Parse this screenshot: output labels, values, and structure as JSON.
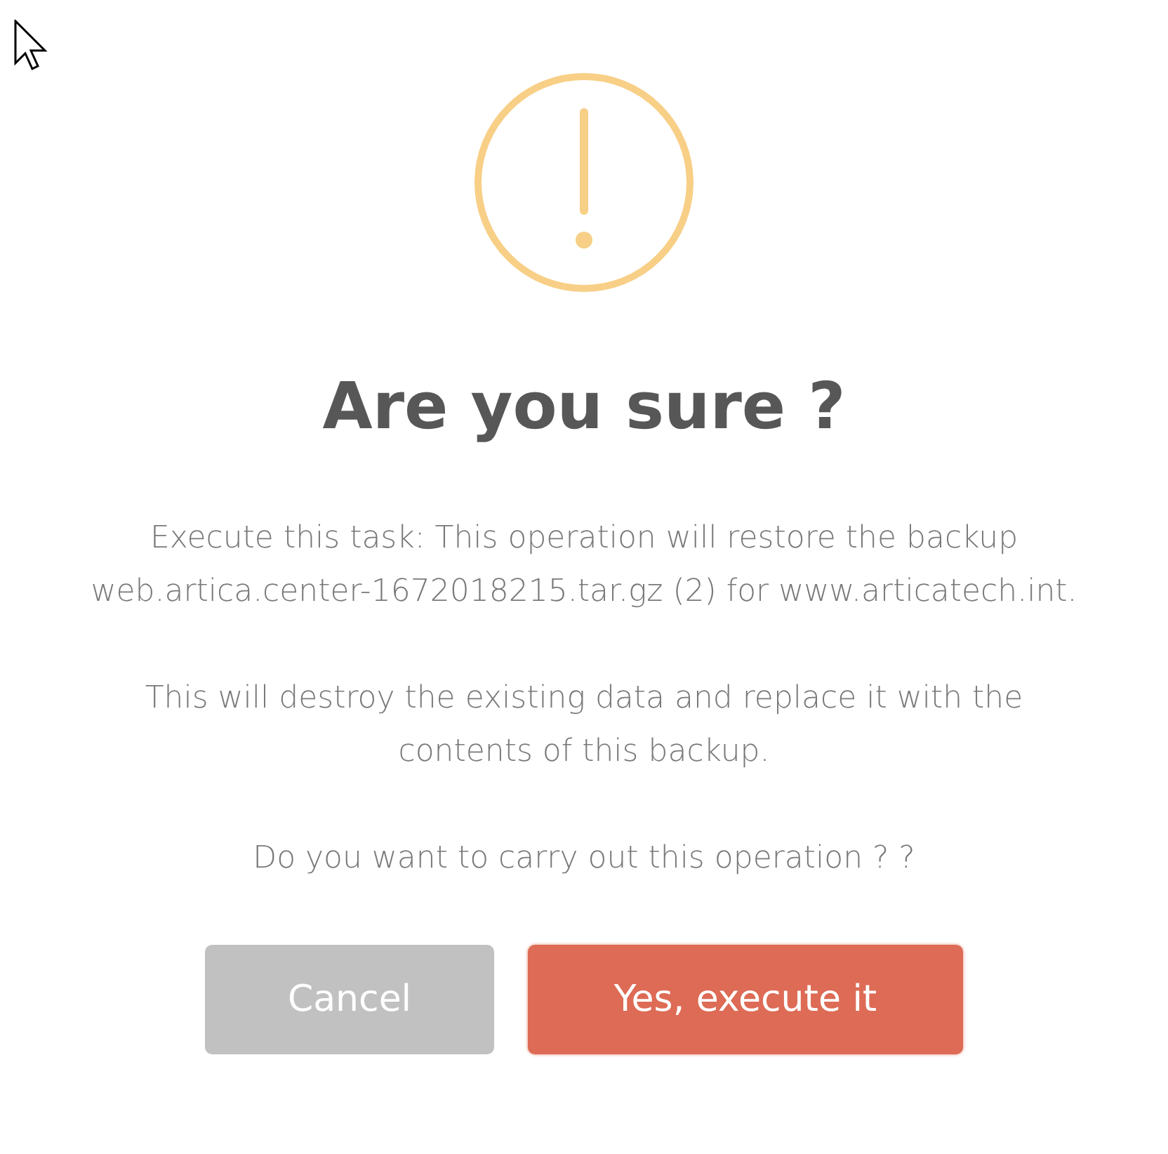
{
  "dialog": {
    "icon": {
      "kind": "warning"
    },
    "title": "Are you sure ?",
    "paragraphs": [
      "Execute this task: This operation will restore the backup web.artica.center-1672018215.tar.gz (2) for www.articatech.int.",
      "This will destroy the existing data and replace it with the contents of this backup.",
      "Do you want to carry out this operation ? ?"
    ],
    "buttons": [
      {
        "label": "Cancel",
        "kind": "cancel"
      },
      {
        "label": "Yes, execute it",
        "kind": "confirm"
      }
    ]
  }
}
